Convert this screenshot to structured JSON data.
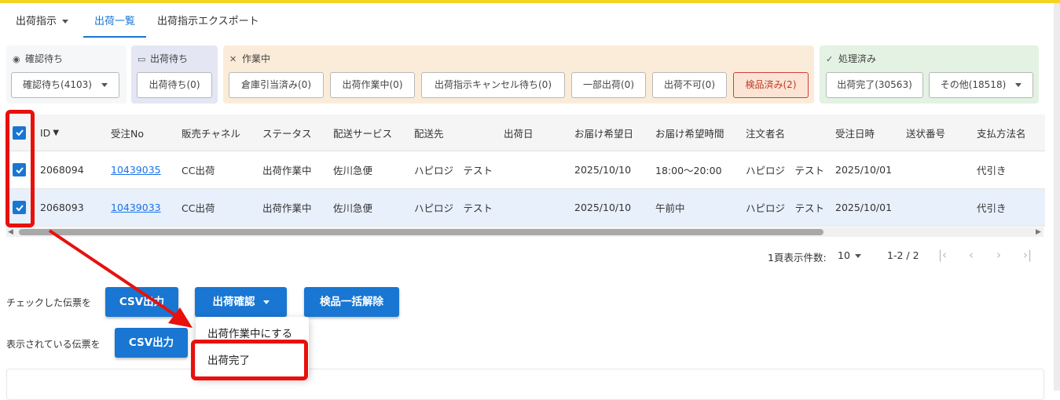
{
  "tabs": [
    {
      "label": "出荷指示"
    },
    {
      "label": "出荷一覧"
    },
    {
      "label": "出荷指示エクスポート"
    }
  ],
  "groups": {
    "confirm": {
      "title": "確認待ち",
      "buttons": [
        "確認待ち(4103)"
      ]
    },
    "waiting": {
      "title": "出荷待ち",
      "buttons": [
        "出荷待ち(0)"
      ]
    },
    "working": {
      "title": "作業中",
      "buttons": [
        "倉庫引当済み(0)",
        "出荷作業中(0)",
        "出荷指示キャンセル待ち(0)",
        "一部出荷(0)",
        "出荷不可(0)",
        "検品済み(2)"
      ]
    },
    "done": {
      "title": "処理済み",
      "buttons": [
        "出荷完了(30563)",
        "その他(18518)"
      ]
    }
  },
  "table": {
    "headers": [
      "ID",
      "受注No",
      "販売チャネル",
      "ステータス",
      "配送サービス",
      "配送先",
      "出荷日",
      "お届け希望日",
      "お届け希望時間",
      "注文者名",
      "受注日時",
      "送状番号",
      "支払方法名"
    ],
    "rows": [
      [
        "2068094",
        "10439035",
        "CC出荷",
        "出荷作業中",
        "佐川急便",
        "ハピロジ　テスト",
        "",
        "2025/10/10",
        "18:00～20:00",
        "ハピロジ　テスト",
        "2025/10/01",
        "",
        "代引き"
      ],
      [
        "2068093",
        "10439033",
        "CC出荷",
        "出荷作業中",
        "佐川急便",
        "ハピロジ　テスト",
        "",
        "2025/10/10",
        "午前中",
        "ハピロジ　テスト",
        "2025/10/01",
        "",
        "代引き"
      ]
    ]
  },
  "pagination": {
    "per_page_label": "1頁表示件数:",
    "per_page": "10",
    "range": "1-2 / 2"
  },
  "actions": {
    "checked_label": "チェックした伝票を",
    "displayed_label": "表示されている伝票を",
    "csv": "CSV出力",
    "confirm": "出荷確認",
    "release": "検品一括解除",
    "menu": [
      "出荷作業中にする",
      "出荷完了"
    ]
  },
  "colors": {
    "accent": "#1976d2",
    "highlight": "#e8100c",
    "topbar": "#f5d320"
  }
}
